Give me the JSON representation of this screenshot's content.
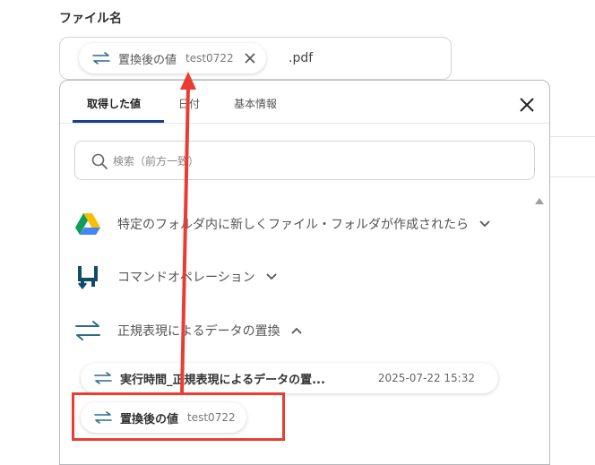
{
  "field": {
    "label": "ファイル名",
    "chip_name": "置換後の値",
    "chip_value": "test0722",
    "suffix": ".pdf"
  },
  "popover": {
    "tabs": [
      {
        "label": "取得した値",
        "active": true
      },
      {
        "label": "日付",
        "active": false
      },
      {
        "label": "基本情報",
        "active": false
      }
    ],
    "search_placeholder": "検索（前方一致）",
    "sections": [
      {
        "label": "特定のフォルダ内に新しくファイル・フォルダが作成されたら",
        "icon": "google-drive-icon",
        "expanded": false
      },
      {
        "label": "コマンドオペレーション",
        "icon": "command-operation-icon",
        "expanded": false
      },
      {
        "label": "正規表現によるデータの置換",
        "icon": "swap-arrows-icon",
        "expanded": true
      }
    ],
    "items": [
      {
        "name": "実行時間_正規表現によるデータの置...",
        "value": "2025-07-22 15:32"
      },
      {
        "name": "置換後の値",
        "value": "test0722"
      }
    ]
  },
  "colors": {
    "accent": "#1a3f8a",
    "highlight": "#e83d30",
    "swap_icon": "#2b6c8c"
  }
}
